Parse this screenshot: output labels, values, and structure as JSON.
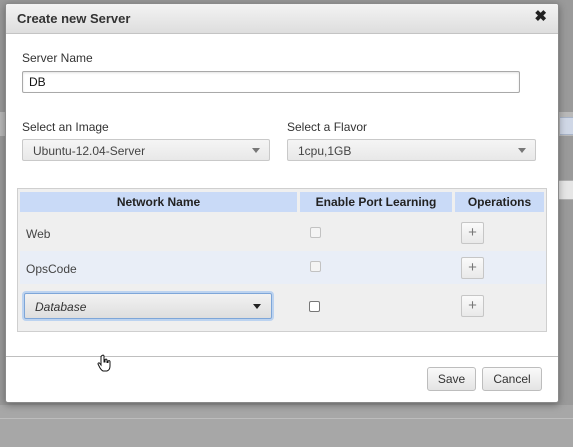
{
  "dialog": {
    "title": "Create new Server",
    "close_glyph": "✖"
  },
  "form": {
    "server_name_label": "Server Name",
    "server_name_value": "DB",
    "image_label": "Select an Image",
    "image_value": "Ubuntu-12.04-Server",
    "flavor_label": "Select a Flavor",
    "flavor_value": "1cpu,1GB"
  },
  "network_table": {
    "columns": [
      "Network Name",
      "Enable Port Learning",
      "Operations"
    ],
    "rows": [
      {
        "network": "Web",
        "port_learning": false
      },
      {
        "network": "OpsCode",
        "port_learning": false
      }
    ],
    "new_row": {
      "selected_network": "Database",
      "port_learning": false
    },
    "add_glyph": "+"
  },
  "footer": {
    "save_label": "Save",
    "cancel_label": "Cancel"
  },
  "colors": {
    "header_bg": "#c9daf7",
    "alt_row_bg": "#e9eef7",
    "backdrop": "#9a9a9a"
  },
  "icons": {
    "close": "close-icon",
    "add": "plus-icon",
    "dropdown": "chevron-down-icon",
    "cursor": "hand-cursor-icon"
  }
}
